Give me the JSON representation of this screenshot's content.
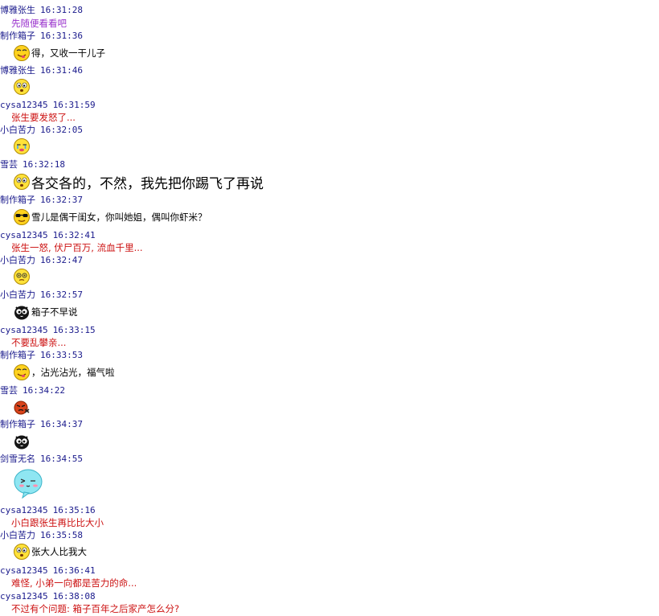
{
  "messages": [
    {
      "sender": "博雅张生",
      "time": "16:31:28",
      "text": "先随便看看吧",
      "color": "#9932cc",
      "icon": "",
      "sender_latin": false
    },
    {
      "sender": "制作箱子",
      "time": "16:31:36",
      "text": "得，又收一干儿子",
      "color": "#000000",
      "icon": "tongue-out-emoticon-icon",
      "sender_latin": false
    },
    {
      "sender": "博雅张生",
      "time": "16:31:46",
      "text": "",
      "color": "#000000",
      "icon": "surprised-emoticon-icon",
      "sender_latin": false
    },
    {
      "sender": "cysa12345",
      "time": "16:31:59",
      "text": "张生要发怒了...",
      "color": "#cc1111",
      "icon": "",
      "sender_latin": true
    },
    {
      "sender": "小白苦力",
      "time": "16:32:05",
      "text": "",
      "color": "#000000",
      "icon": "crying-emoticon-icon",
      "sender_latin": false
    },
    {
      "sender": "雪芸",
      "time": "16:32:18",
      "text": "各交各的，不然，我先把你踢飞了再说",
      "color": "#000000",
      "icon": "surprised-emoticon-icon",
      "sender_latin": false
    },
    {
      "sender": "制作箱子",
      "time": "16:32:37",
      "text": "雪儿是偶干闺女，你叫她姐，偶叫你虾米？",
      "color": "#000000",
      "icon": "cool-sunglasses-emoticon-icon",
      "sender_latin": false
    },
    {
      "sender": "cysa12345",
      "time": "16:32:41",
      "text": "张生一怒, 伏尸百万, 流血千里...",
      "color": "#cc1111",
      "icon": "",
      "sender_latin": true
    },
    {
      "sender": "小白苦力",
      "time": "16:32:47",
      "text": "",
      "color": "#000000",
      "icon": "dizzy-emoticon-icon",
      "sender_latin": false
    },
    {
      "sender": "小白苦力",
      "time": "16:32:57",
      "text": "箱子不早说",
      "color": "#000000",
      "icon": "black-owl-emoticon-icon",
      "sender_latin": false
    },
    {
      "sender": "cysa12345",
      "time": "16:33:15",
      "text": "不要乱攀亲...",
      "color": "#cc1111",
      "icon": "",
      "sender_latin": true
    },
    {
      "sender": "制作箱子",
      "time": "16:33:53",
      "text": "，沾光沾光，福气啦",
      "color": "#000000",
      "icon": "tongue-out-emoticon-icon",
      "sender_latin": false
    },
    {
      "sender": "雪芸",
      "time": "16:34:22",
      "text": "",
      "color": "#000000",
      "icon": "angry-red-emoticon-icon",
      "sender_latin": false
    },
    {
      "sender": "制作箱子",
      "time": "16:34:37",
      "text": "",
      "color": "#000000",
      "icon": "black-owl-emoticon-icon",
      "sender_latin": false
    },
    {
      "sender": "剑雪无名",
      "time": "16:34:55",
      "text": "",
      "color": "#000000",
      "icon": "blue-speech-bubble-face-icon",
      "sender_latin": false
    },
    {
      "sender": "cysa12345",
      "time": "16:35:16",
      "text": "小白跟张生再比比大小",
      "color": "#cc1111",
      "icon": "",
      "sender_latin": true
    },
    {
      "sender": "小白苦力",
      "time": "16:35:58",
      "text": "张大人比我大",
      "color": "#000000",
      "icon": "surprised-emoticon-icon",
      "sender_latin": false
    },
    {
      "sender": "cysa12345",
      "time": "16:36:41",
      "text": "难怪, 小弟一向都是苦力的命...",
      "color": "#cc1111",
      "icon": "",
      "sender_latin": true
    },
    {
      "sender": "cysa12345",
      "time": "16:38:08",
      "text": "不过有个问题: 箱子百年之后家产怎么分?",
      "color": "#cc1111",
      "icon": "",
      "sender_latin": true
    }
  ],
  "colors": {
    "header": "#1a1a8c",
    "message_red": "#cc1111",
    "message_purple": "#9932cc",
    "message_black": "#000000"
  }
}
